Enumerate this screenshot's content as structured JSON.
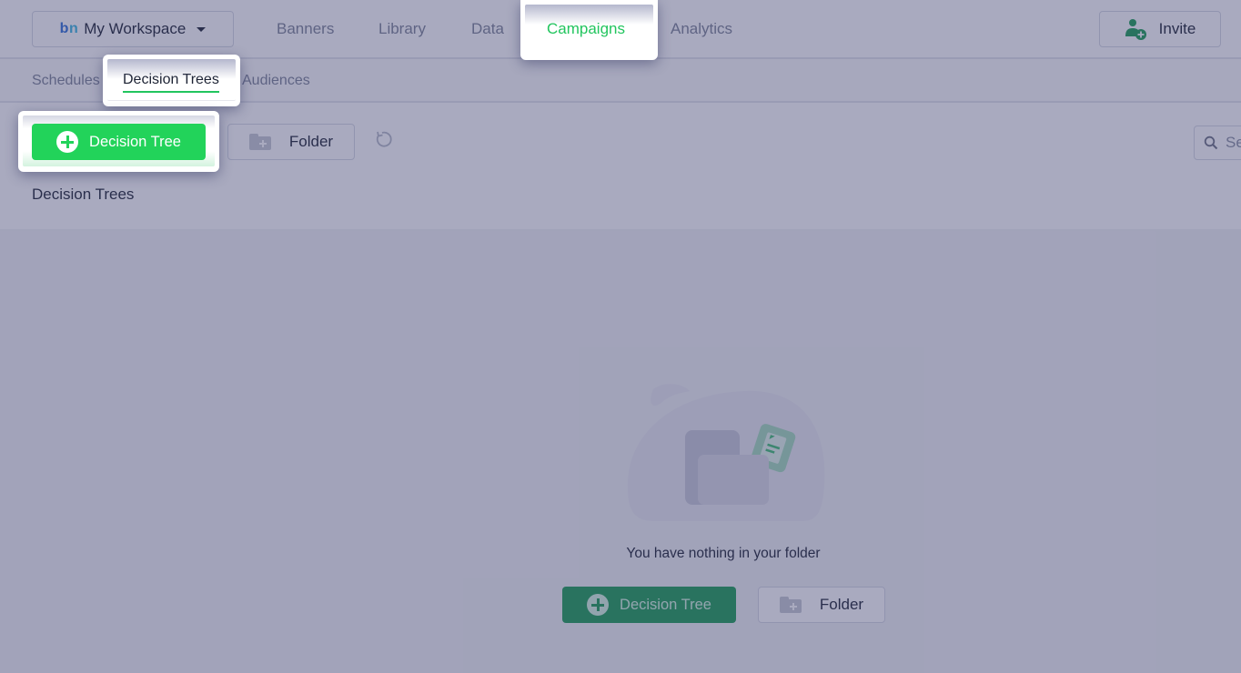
{
  "workspace": {
    "logo_b": "b",
    "logo_n": "n",
    "name": "My Workspace"
  },
  "nav": {
    "items": [
      {
        "label": "Banners",
        "active": false
      },
      {
        "label": "Library",
        "active": false
      },
      {
        "label": "Data",
        "active": false
      },
      {
        "label": "Campaigns",
        "active": true
      },
      {
        "label": "Analytics",
        "active": false
      }
    ],
    "invite_label": "Invite"
  },
  "subnav": {
    "items": [
      {
        "label": "Schedules",
        "active": false
      },
      {
        "label": "Decision Trees",
        "active": true
      },
      {
        "label": "Audiences",
        "active": false
      }
    ]
  },
  "toolbar": {
    "new_decision_tree_label": "Decision Tree",
    "new_folder_label": "Folder",
    "search_placeholder": "Search"
  },
  "section": {
    "title": "Decision Trees"
  },
  "empty_state": {
    "message": "You have nothing in your folder",
    "decision_tree_label": "Decision Tree",
    "folder_label": "Folder"
  },
  "colors": {
    "accent_green": "#22c55e",
    "primary_button": "#22d35a",
    "overlay": "#3c3e6e"
  }
}
